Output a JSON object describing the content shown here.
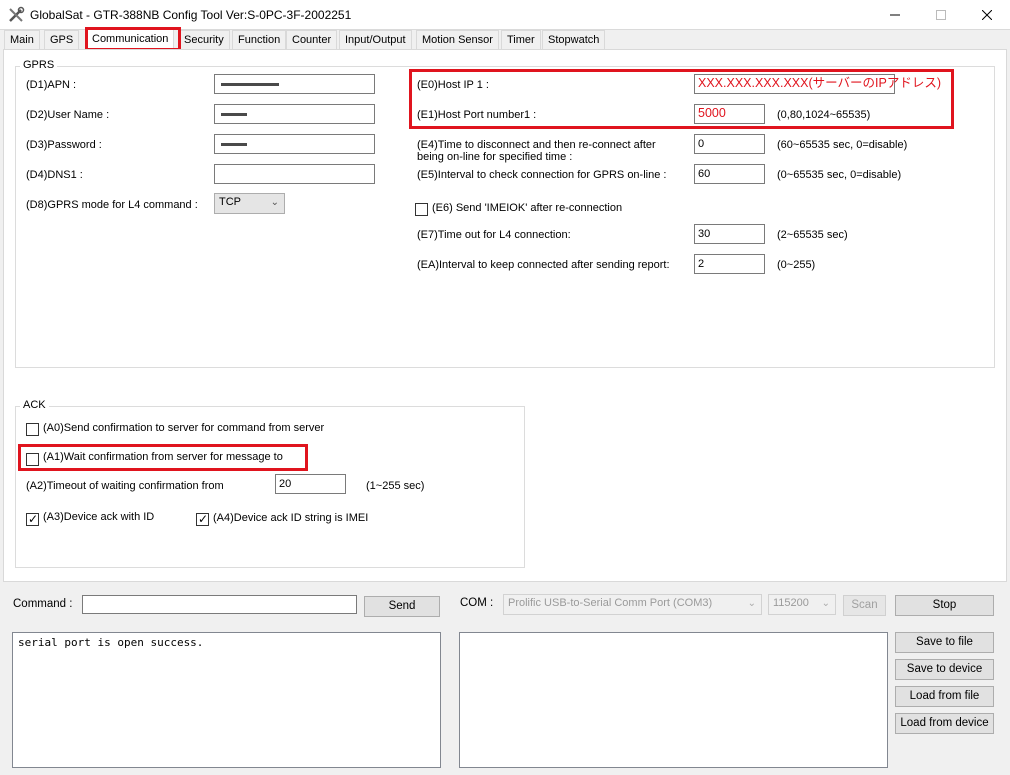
{
  "window": {
    "title": "GlobalSat - GTR-388NB Config Tool Ver:S-0PC-3F-2002251",
    "icons": {
      "app": "tools-icon",
      "minimize": "minimize-icon",
      "maximize": "maximize-icon",
      "close": "close-icon"
    }
  },
  "tabs": [
    "Main",
    "GPS",
    "Communication",
    "Security",
    "Function",
    "Counter",
    "Input/Output",
    "Motion Sensor",
    "Timer",
    "Stopwatch"
  ],
  "active_tab": "Communication",
  "gprs": {
    "title": "GPRS",
    "d1_label": "(D1)APN :",
    "d2_label": "(D2)User Name :",
    "d3_label": "(D3)Password :",
    "d4_label": "(D4)DNS1 :",
    "d4_value": "",
    "d8_label": "(D8)GPRS mode for L4 command :",
    "d8_value": "TCP",
    "e0_label": "(E0)Host IP 1 :",
    "e0_value": "XXX.XXX.XXX.XXX(サーバーのIPアドレス)",
    "e1_label": "(E1)Host Port number1 :",
    "e1_value": "5000",
    "e1_hint": "(0,80,1024~65535)",
    "e4_label_line1": "(E4)Time to disconnect and then re-connect after",
    "e4_label_line2": "being on-line for specified time :",
    "e4_value": "0",
    "e4_hint": "(60~65535 sec, 0=disable)",
    "e5_label": "(E5)Interval to check connection for GPRS on-line :",
    "e5_value": "60",
    "e5_hint": "(0~65535 sec, 0=disable)",
    "e6_label": "(E6) Send 'IMEIOK' after re-connection",
    "e6_checked": false,
    "e7_label": "(E7)Time out for L4 connection:",
    "e7_value": "30",
    "e7_hint": "(2~65535 sec)",
    "ea_label": "(EA)Interval to keep connected after sending report:",
    "ea_value": "2",
    "ea_hint": "(0~255)"
  },
  "ack": {
    "title": "ACK",
    "a0_label": "(A0)Send confirmation to server for command from server",
    "a0_checked": false,
    "a1_label": "(A1)Wait confirmation from server for message to",
    "a1_checked": false,
    "a2_label": "(A2)Timeout of waiting confirmation from",
    "a2_value": "20",
    "a2_hint": "(1~255 sec)",
    "a3_label": "(A3)Device ack with ID",
    "a3_checked": true,
    "a4_label": "(A4)Device ack ID string is IMEI",
    "a4_checked": true
  },
  "bottom": {
    "command_label": "Command :",
    "command_value": "",
    "send_button": "Send",
    "com_label": "COM :",
    "com_port": "Prolific USB-to-Serial Comm Port  (COM3)",
    "baud": "115200",
    "scan_button": "Scan",
    "stop_button": "Stop",
    "log_text": "serial port is open success.",
    "save_file_button": "Save to file",
    "save_device_button": "Save to device",
    "load_file_button": "Load from file",
    "load_device_button": "Load from device"
  },
  "colors": {
    "highlight": "#e0141e",
    "tab_active_bg": "#ffffff"
  }
}
